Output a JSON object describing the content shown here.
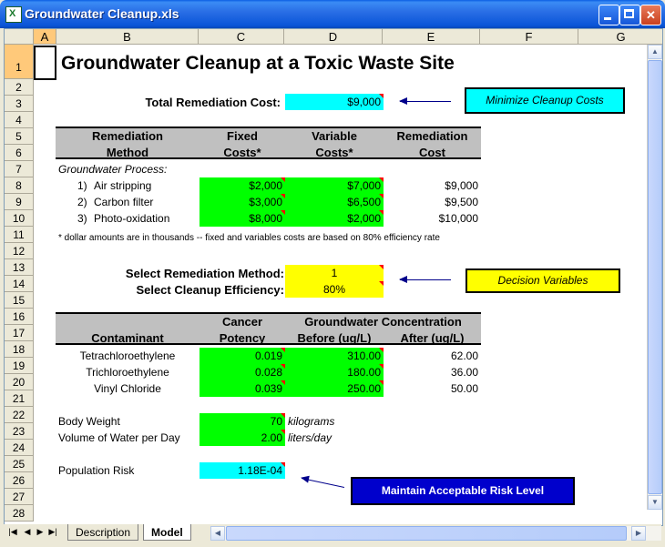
{
  "window": {
    "title": "Groundwater Cleanup.xls"
  },
  "columns": [
    "A",
    "B",
    "C",
    "D",
    "E",
    "F",
    "G"
  ],
  "rows": [
    "1",
    "2",
    "3",
    "4",
    "5",
    "6",
    "7",
    "8",
    "9",
    "10",
    "11",
    "12",
    "13",
    "14",
    "15",
    "16",
    "17",
    "18",
    "19",
    "20",
    "21",
    "22",
    "23",
    "24",
    "25",
    "26",
    "27",
    "28"
  ],
  "sheet": {
    "title": "Groundwater Cleanup at a Toxic Waste Site",
    "total_cost_label": "Total Remediation Cost:",
    "total_cost_value": "$9,000",
    "header_remediation": "Remediation",
    "header_method": "Method",
    "header_fixed": "Fixed",
    "header_fixed2": "Costs*",
    "header_variable": "Variable",
    "header_variable2": "Costs*",
    "header_remcost": "Remediation",
    "header_remcost2": "Cost",
    "process_label": "Groundwater Process:",
    "methods": [
      {
        "num": "1)",
        "name": "Air stripping",
        "fixed": "$2,000",
        "variable": "$7,000",
        "cost": "$9,000"
      },
      {
        "num": "2)",
        "name": "Carbon filter",
        "fixed": "$3,000",
        "variable": "$6,500",
        "cost": "$9,500"
      },
      {
        "num": "3)",
        "name": "Photo-oxidation",
        "fixed": "$8,000",
        "variable": "$2,000",
        "cost": "$10,000"
      }
    ],
    "footnote": "* dollar amounts are in thousands -- fixed and variables costs are based on 80% efficiency rate",
    "select_method_label": "Select Remediation Method:",
    "select_method_value": "1",
    "select_eff_label": "Select Cleanup Efficiency:",
    "select_eff_value": "80%",
    "cancer_label": "Cancer",
    "potency_label": "Potency",
    "gw_conc_label": "Groundwater Concentration",
    "contaminant_label": "Contaminant",
    "before_label": "Before (ug/L)",
    "after_label": "After (ug/L)",
    "contaminants": [
      {
        "name": "Tetrachloroethylene",
        "potency": "0.019",
        "before": "310.00",
        "after": "62.00"
      },
      {
        "name": "Trichloroethylene",
        "potency": "0.028",
        "before": "180.00",
        "after": "36.00"
      },
      {
        "name": "Vinyl Chloride",
        "potency": "0.039",
        "before": "250.00",
        "after": "50.00"
      }
    ],
    "body_weight_label": "Body Weight",
    "body_weight_value": "70",
    "body_weight_unit": "kilograms",
    "water_label": "Volume of Water per Day",
    "water_value": "2.00",
    "water_unit": "liters/day",
    "risk_label": "Population Risk",
    "risk_value": "1.18E-04"
  },
  "callouts": {
    "minimize": "Minimize Cleanup Costs",
    "decision": "Decision Variables",
    "risk": "Maintain Acceptable Risk Level"
  },
  "tabs": [
    "Description",
    "Model"
  ],
  "colors": {
    "green": "#00ff00",
    "cyan": "#00ffff",
    "yellow": "#ffff00",
    "gray": "#c0c0c0",
    "risk_callout": "#0000cc"
  }
}
